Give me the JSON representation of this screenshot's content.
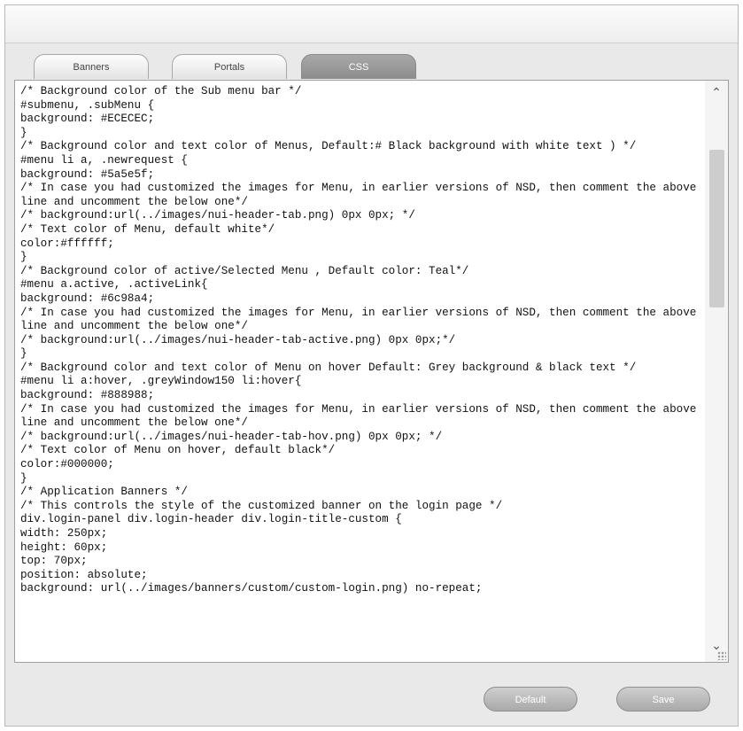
{
  "tabs": [
    {
      "label": "Banners",
      "active": false
    },
    {
      "label": "Portals",
      "active": false
    },
    {
      "label": "CSS",
      "active": true
    }
  ],
  "editor": {
    "lines": [
      "/* Background color of the Sub menu bar */",
      "#submenu, .subMenu {",
      "background: #ECECEC;",
      "}",
      "/* Background color and text color of Menus, Default:# Black background with white text ) */",
      "#menu li a, .newrequest {",
      "background: #5a5e5f;",
      "/* In case you had customized the images for Menu, in earlier versions of NSD, then comment the above line and uncomment the below one*/",
      "/* background:url(../images/nui-header-tab.png) 0px 0px; */",
      "/* Text color of Menu, default white*/",
      "color:#ffffff;",
      "}",
      "/* Background color of active/Selected Menu , Default color: Teal*/",
      "#menu a.active, .activeLink{",
      "background: #6c98a4;",
      "/* In case you had customized the images for Menu, in earlier versions of NSD, then comment the above line and uncomment the below one*/",
      "/* background:url(../images/nui-header-tab-active.png) 0px 0px;*/",
      "}",
      "/* Background color and text color of Menu on hover Default: Grey background & black text */",
      "#menu li a:hover, .greyWindow150 li:hover{",
      "background: #888988;",
      "/* In case you had customized the images for Menu, in earlier versions of NSD, then comment the above line and uncomment the below one*/",
      "/* background:url(../images/nui-header-tab-hov.png) 0px 0px; */",
      "/* Text color of Menu on hover, default black*/",
      "color:#000000;",
      "}",
      "/* Application Banners */",
      "/* This controls the style of the customized banner on the login page */",
      "div.login-panel div.login-header div.login-title-custom {",
      "width: 250px;",
      "height: 60px;",
      "top: 70px;",
      "position: absolute;",
      "background: url(../images/banners/custom/custom-login.png) no-repeat;"
    ]
  },
  "buttons": {
    "default_label": "Default",
    "save_label": "Save"
  },
  "scrollbar": {
    "up_glyph": "^",
    "down_glyph": "v"
  }
}
